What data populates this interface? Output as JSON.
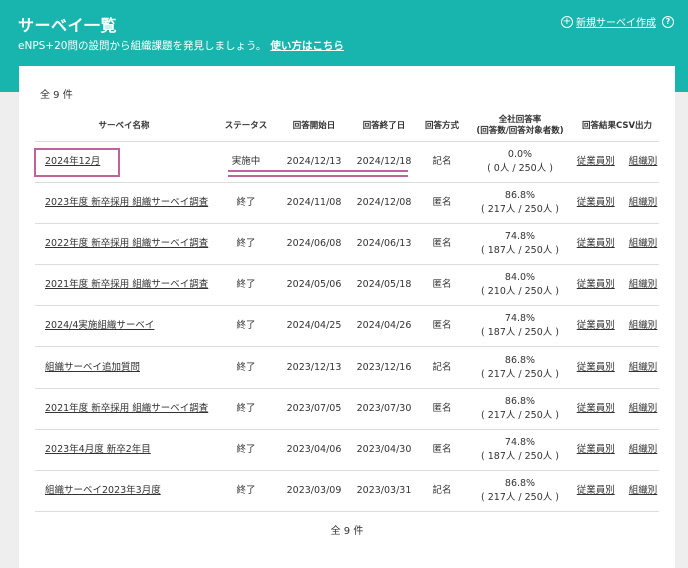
{
  "header": {
    "title": "サーベイ一覧",
    "description": "eNPS+20問の設問から組織課題を発見しましょう。",
    "howto_link": "使い方はこちら",
    "new_survey": "新規サーベイ作成",
    "help": "?"
  },
  "count_label": "全 9 件",
  "columns": {
    "name": "サーベイ名称",
    "status": "ステータス",
    "start": "回答開始日",
    "end": "回答終了日",
    "method": "回答方式",
    "rate_line1": "全社回答率",
    "rate_line2": "(回答数/回答対象者数)",
    "csv": "回答結果CSV出力"
  },
  "csv_labels": {
    "employee": "従業員別",
    "org": "組織別"
  },
  "surveys": [
    {
      "name": "2024年12月",
      "status": "実施中",
      "start": "2024/12/13",
      "end": "2024/12/18",
      "method": "記名",
      "rate": "0.0%",
      "counts": "( 0人 / 250人 )"
    },
    {
      "name": "2023年度 新卒採用 組織サーベイ調査",
      "status": "終了",
      "start": "2024/11/08",
      "end": "2024/12/08",
      "method": "匿名",
      "rate": "86.8%",
      "counts": "( 217人 / 250人 )"
    },
    {
      "name": "2022年度 新卒採用 組織サーベイ調査",
      "status": "終了",
      "start": "2024/06/08",
      "end": "2024/06/13",
      "method": "匿名",
      "rate": "74.8%",
      "counts": "( 187人 / 250人 )"
    },
    {
      "name": "2021年度 新卒採用 組織サーベイ調査",
      "status": "終了",
      "start": "2024/05/06",
      "end": "2024/05/18",
      "method": "匿名",
      "rate": "84.0%",
      "counts": "( 210人 / 250人 )"
    },
    {
      "name": "2024/4実施組織サーベイ",
      "status": "終了",
      "start": "2024/04/25",
      "end": "2024/04/26",
      "method": "匿名",
      "rate": "74.8%",
      "counts": "( 187人 / 250人 )"
    },
    {
      "name": "組織サーベイ追加質問",
      "status": "終了",
      "start": "2023/12/13",
      "end": "2023/12/16",
      "method": "記名",
      "rate": "86.8%",
      "counts": "( 217人 / 250人 )"
    },
    {
      "name": "2021年度 新卒採用 組織サーベイ調査",
      "status": "終了",
      "start": "2023/07/05",
      "end": "2023/07/30",
      "method": "匿名",
      "rate": "86.8%",
      "counts": "( 217人 / 250人 )"
    },
    {
      "name": "2023年4月度 新卒2年目",
      "status": "終了",
      "start": "2023/04/06",
      "end": "2023/04/30",
      "method": "匿名",
      "rate": "74.8%",
      "counts": "( 187人 / 250人 )"
    },
    {
      "name": "組織サーベイ2023年3月度",
      "status": "終了",
      "start": "2023/03/09",
      "end": "2023/03/31",
      "method": "記名",
      "rate": "86.8%",
      "counts": "( 217人 / 250人 )"
    }
  ],
  "annotation_color": "#c2619b",
  "brand_color": "#17b5ad"
}
